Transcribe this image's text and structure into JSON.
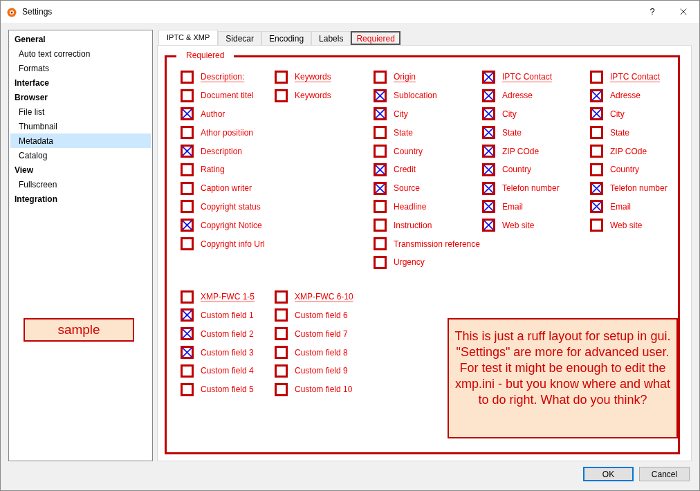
{
  "window": {
    "title": "Settings",
    "help": "?"
  },
  "sidebar": {
    "items": [
      {
        "label": "General",
        "selected": false,
        "children": [
          {
            "label": "Auto text correction",
            "selected": false
          },
          {
            "label": "Formats",
            "selected": false
          }
        ]
      },
      {
        "label": "Interface",
        "selected": false
      },
      {
        "label": "Browser",
        "selected": false,
        "children": [
          {
            "label": "File list",
            "selected": false
          },
          {
            "label": "Thumbnail",
            "selected": false
          },
          {
            "label": "Metadata",
            "selected": true
          },
          {
            "label": "Catalog",
            "selected": false
          }
        ]
      },
      {
        "label": "View",
        "selected": false,
        "children": [
          {
            "label": "Fullscreen",
            "selected": false
          }
        ]
      },
      {
        "label": "Integration",
        "selected": false
      }
    ]
  },
  "sample_label": "sample",
  "tabs": [
    {
      "label": "IPTC & XMP",
      "selected": true,
      "kind": "native"
    },
    {
      "label": "Sidecar",
      "selected": false,
      "kind": "native"
    },
    {
      "label": "Encoding",
      "selected": false,
      "kind": "native"
    },
    {
      "label": "Labels",
      "selected": false,
      "kind": "native"
    },
    {
      "label": "Requiered",
      "selected": false,
      "kind": "mockup"
    }
  ],
  "group": {
    "title": "Requiered",
    "columns": [
      [
        {
          "kind": "header",
          "label": "Description:",
          "checked": false
        },
        {
          "kind": "field",
          "label": "Document titel",
          "checked": false
        },
        {
          "kind": "field",
          "label": "Author",
          "checked": true
        },
        {
          "kind": "field",
          "label": "Athor positiion",
          "checked": false
        },
        {
          "kind": "field",
          "label": "Description",
          "checked": true
        },
        {
          "kind": "field",
          "label": "Rating",
          "checked": false
        },
        {
          "kind": "field",
          "label": "Caption writer",
          "checked": false
        },
        {
          "kind": "field",
          "label": "Copyright status",
          "checked": false
        },
        {
          "kind": "field",
          "label": "Copyright Notice",
          "checked": true
        },
        {
          "kind": "field",
          "label": "Copyright info Url",
          "checked": false
        }
      ],
      [
        {
          "kind": "header",
          "label": "Keywords",
          "checked": false
        },
        {
          "kind": "field",
          "label": "Keywords",
          "checked": false
        }
      ],
      [
        {
          "kind": "header",
          "label": "Origin",
          "checked": false
        },
        {
          "kind": "field",
          "label": "Sublocation",
          "checked": true
        },
        {
          "kind": "field",
          "label": "City",
          "checked": true
        },
        {
          "kind": "field",
          "label": "State",
          "checked": false
        },
        {
          "kind": "field",
          "label": "Country",
          "checked": false
        },
        {
          "kind": "field",
          "label": "Credit",
          "checked": true
        },
        {
          "kind": "field",
          "label": "Source",
          "checked": true
        },
        {
          "kind": "field",
          "label": "Headline",
          "checked": false
        },
        {
          "kind": "field",
          "label": "Instruction",
          "checked": false
        },
        {
          "kind": "field",
          "label": "Transmission reference",
          "checked": false
        },
        {
          "kind": "field",
          "label": "Urgency",
          "checked": false
        }
      ],
      [
        {
          "kind": "header",
          "label": "IPTC Contact",
          "checked": true
        },
        {
          "kind": "field",
          "label": "Adresse",
          "checked": true
        },
        {
          "kind": "field",
          "label": "City",
          "checked": true
        },
        {
          "kind": "field",
          "label": "State",
          "checked": true
        },
        {
          "kind": "field",
          "label": "ZIP COde",
          "checked": true
        },
        {
          "kind": "field",
          "label": "Country",
          "checked": true
        },
        {
          "kind": "field",
          "label": "Telefon number",
          "checked": true
        },
        {
          "kind": "field",
          "label": "Email",
          "checked": true
        },
        {
          "kind": "field",
          "label": "Web site",
          "checked": true
        }
      ],
      [
        {
          "kind": "header",
          "label": "IPTC Contact",
          "checked": false
        },
        {
          "kind": "field",
          "label": "Adresse",
          "checked": true
        },
        {
          "kind": "field",
          "label": "City",
          "checked": true
        },
        {
          "kind": "field",
          "label": "State",
          "checked": false
        },
        {
          "kind": "field",
          "label": "ZIP COde",
          "checked": false
        },
        {
          "kind": "field",
          "label": "Country",
          "checked": false
        },
        {
          "kind": "field",
          "label": "Telefon number",
          "checked": true
        },
        {
          "kind": "field",
          "label": "Email",
          "checked": true
        },
        {
          "kind": "field",
          "label": "Web site",
          "checked": false
        }
      ]
    ],
    "custom_columns": [
      [
        {
          "kind": "header",
          "label": "XMP-FWC 1-5",
          "checked": false
        },
        {
          "kind": "field",
          "label": "Custom field 1",
          "checked": true
        },
        {
          "kind": "field",
          "label": "Custom field 2",
          "checked": true
        },
        {
          "kind": "field",
          "label": "Custom field 3",
          "checked": true
        },
        {
          "kind": "field",
          "label": "Custom field 4",
          "checked": false
        },
        {
          "kind": "field",
          "label": "Custom field 5",
          "checked": false
        }
      ],
      [
        {
          "kind": "header",
          "label": "XMP-FWC 6-10",
          "checked": false
        },
        {
          "kind": "field",
          "label": "Custom field 6",
          "checked": false
        },
        {
          "kind": "field",
          "label": "Custom field 7",
          "checked": false
        },
        {
          "kind": "field",
          "label": "Custom field 8",
          "checked": false
        },
        {
          "kind": "field",
          "label": "Custom field 9",
          "checked": false
        },
        {
          "kind": "field",
          "label": "Custom field 10",
          "checked": false
        }
      ]
    ],
    "note": "This is just a ruff layout for setup in gui. \"Settings\" are more for advanced user. For test it might be enough to edit the xmp.ini - but you know where and what to do right. What do you think?"
  },
  "buttons": [
    "OK",
    "Cancel"
  ]
}
